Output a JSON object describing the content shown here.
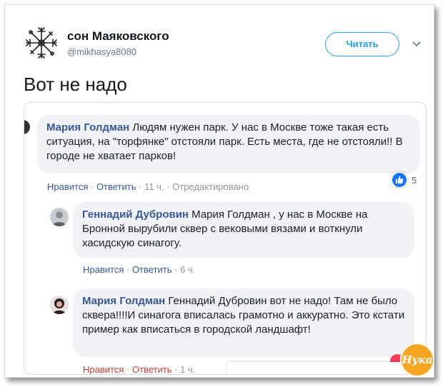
{
  "tweet": {
    "author_name": "сон Маяковского",
    "author_handle": "@mikhasya8080",
    "follow_label": "Читать",
    "text": "Вот не надо",
    "icons": {
      "avatar": "vegvisir-symbol-icon",
      "menu": "chevron-down-icon"
    }
  },
  "comments": [
    {
      "name": "Мария Голдман",
      "text": "Людям нужен парк. У нас в Москве тоже такая есть ситуация, на \"торфянке\" отстояли парк. Есть места, где не отстояли!! В городе не хватает парков!",
      "like": "Нравится",
      "reply": "Ответить",
      "time": "11 ч.",
      "edited": "Отредактировано",
      "reaction_count": "5"
    },
    {
      "name": "Геннадий Дубровин",
      "text": "Мария Голдман , у нас в Москве на Бронной вырубили сквер с вековыми вязами и воткнули хасидскую синагогу.",
      "like": "Нравится",
      "reply": "Ответить",
      "time": "6 ч."
    },
    {
      "name": "Мария Голдман",
      "text": "Геннадий Дубровин вот не надо! Там не было сквера!!!!И синагога вписалась грамотно и аккуратно. Это кстати пример как вписаться в городской ландшафт!",
      "like": "Нравится",
      "reply": "Ответить",
      "time": "1 ч."
    }
  ],
  "watermark": "Нука",
  "colors": {
    "twitter_blue": "#1da1f2",
    "fb_link": "#385898",
    "bubble_bg": "#f0f2f5",
    "like_blue": "#1877f2"
  }
}
